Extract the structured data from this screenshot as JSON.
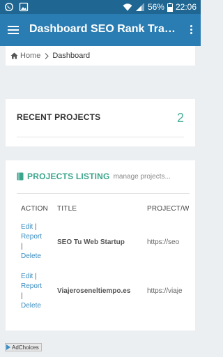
{
  "status_bar": {
    "battery": "56%",
    "time": "22:06",
    "icons": [
      "whatsapp-icon",
      "image-icon",
      "wifi-icon",
      "signal-icon",
      "battery-icon"
    ]
  },
  "app_bar": {
    "title": "Dashboard SEO Rank Tracker",
    "icons": [
      "menu-icon",
      "overflow-menu-icon"
    ]
  },
  "breadcrumb": {
    "home": "Home",
    "current": "Dashboard"
  },
  "recent_projects": {
    "title": "RECENT PROJECTS",
    "count": "2"
  },
  "projects_listing": {
    "title": "PROJECTS LISTING",
    "subtitle": "manage projects...",
    "columns": {
      "action": "ACTION",
      "title": "TITLE",
      "url": "PROJECT/W"
    },
    "rows": [
      {
        "edit": "Edit",
        "report": "Report",
        "delete": "Delete",
        "pipe": "|",
        "title": "SEO Tu Web Startup",
        "url": "https://seo"
      },
      {
        "edit": "Edit",
        "report": "Report",
        "delete": "Delete",
        "pipe": "|",
        "title": "Viajeroseneltiempo.es",
        "url": "https://viaje"
      }
    ]
  },
  "ad": {
    "label": "AdChoices"
  },
  "colors": {
    "status_bar": "#1f6692",
    "app_bar": "#2a7db3",
    "accent_green": "#3aa58c",
    "link_blue": "#3a8cc0"
  }
}
